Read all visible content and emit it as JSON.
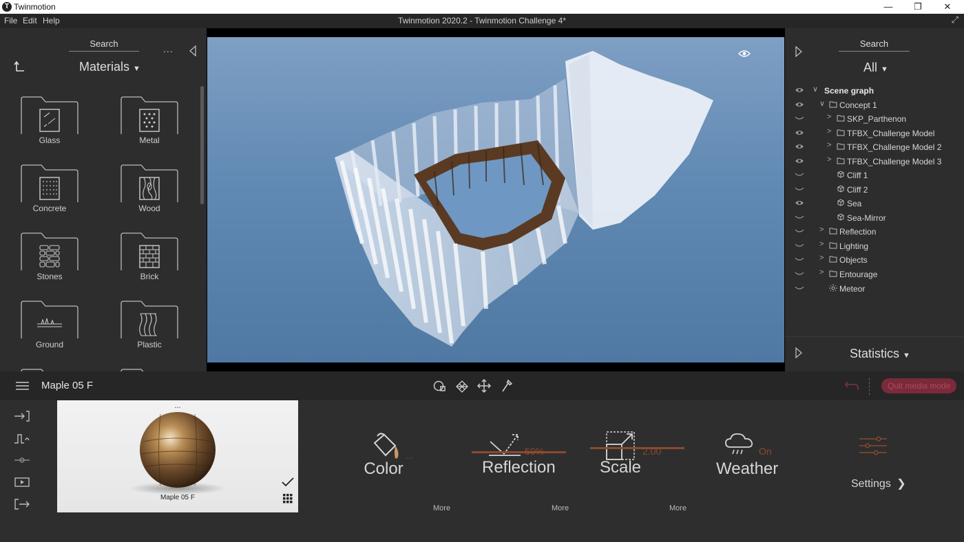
{
  "window": {
    "app_title": "Twinmotion",
    "logo_glyph": "T"
  },
  "menu": {
    "items": [
      "File",
      "Edit",
      "Help"
    ],
    "doc_title": "Twinmotion 2020.2 - Twinmotion Challenge 4*"
  },
  "library": {
    "search_label": "Search",
    "more_glyph": "...",
    "category": "Materials",
    "materials": [
      {
        "label": "Glass",
        "icon": "glass-icon"
      },
      {
        "label": "Metal",
        "icon": "metal-icon"
      },
      {
        "label": "Concrete",
        "icon": "concrete-icon"
      },
      {
        "label": "Wood",
        "icon": "wood-icon"
      },
      {
        "label": "Stones",
        "icon": "stones-icon"
      },
      {
        "label": "Brick",
        "icon": "brick-icon"
      },
      {
        "label": "Ground",
        "icon": "ground-icon"
      },
      {
        "label": "Plastic",
        "icon": "plastic-icon"
      }
    ]
  },
  "scene": {
    "search_label": "Search",
    "filter": "All",
    "statistics_label": "Statistics",
    "tree": [
      {
        "label": "Scene graph",
        "type": "root",
        "visible": true
      },
      {
        "label": "Concept 1",
        "type": "folder",
        "visible": true
      },
      {
        "label": "SKP_Parthenon",
        "type": "folder",
        "visible": false
      },
      {
        "label": "TFBX_Challenge Model",
        "type": "folder",
        "visible": true
      },
      {
        "label": "TFBX_Challenge Model 2",
        "type": "folder",
        "visible": true
      },
      {
        "label": "TFBX_Challenge Model 3",
        "type": "folder",
        "visible": true
      },
      {
        "label": "Cliff 1",
        "type": "object",
        "visible": false
      },
      {
        "label": "Cliff 2",
        "type": "object",
        "visible": false
      },
      {
        "label": "Sea",
        "type": "object",
        "visible": true
      },
      {
        "label": "Sea-Mirror",
        "type": "object",
        "visible": false
      },
      {
        "label": "Reflection",
        "type": "folder",
        "visible": false
      },
      {
        "label": "Lighting",
        "type": "folder",
        "visible": false
      },
      {
        "label": "Objects",
        "type": "folder",
        "visible": false
      },
      {
        "label": "Entourage",
        "type": "folder",
        "visible": false
      },
      {
        "label": "Meteor",
        "type": "light",
        "visible": false
      }
    ]
  },
  "material_panel": {
    "name": "Maple 05 F",
    "preview_label": "Maple 05 F",
    "preview_dots": "...",
    "quit_label": "Quit media mode",
    "tools": {
      "color": {
        "label": "Color",
        "dots": "...",
        "more": "More"
      },
      "reflection": {
        "label": "Reflection",
        "value": "50%",
        "more": "More"
      },
      "scale": {
        "label": "Scale",
        "value": "2.00",
        "more": "More"
      },
      "weather": {
        "label": "Weather",
        "value": "On"
      },
      "settings": {
        "label": "Settings"
      }
    }
  },
  "colors": {
    "accent": "#8c4a2f",
    "quit_bg": "#7a2a3a",
    "quit_text": "#b04a5e",
    "sky": "#5a83ad"
  }
}
